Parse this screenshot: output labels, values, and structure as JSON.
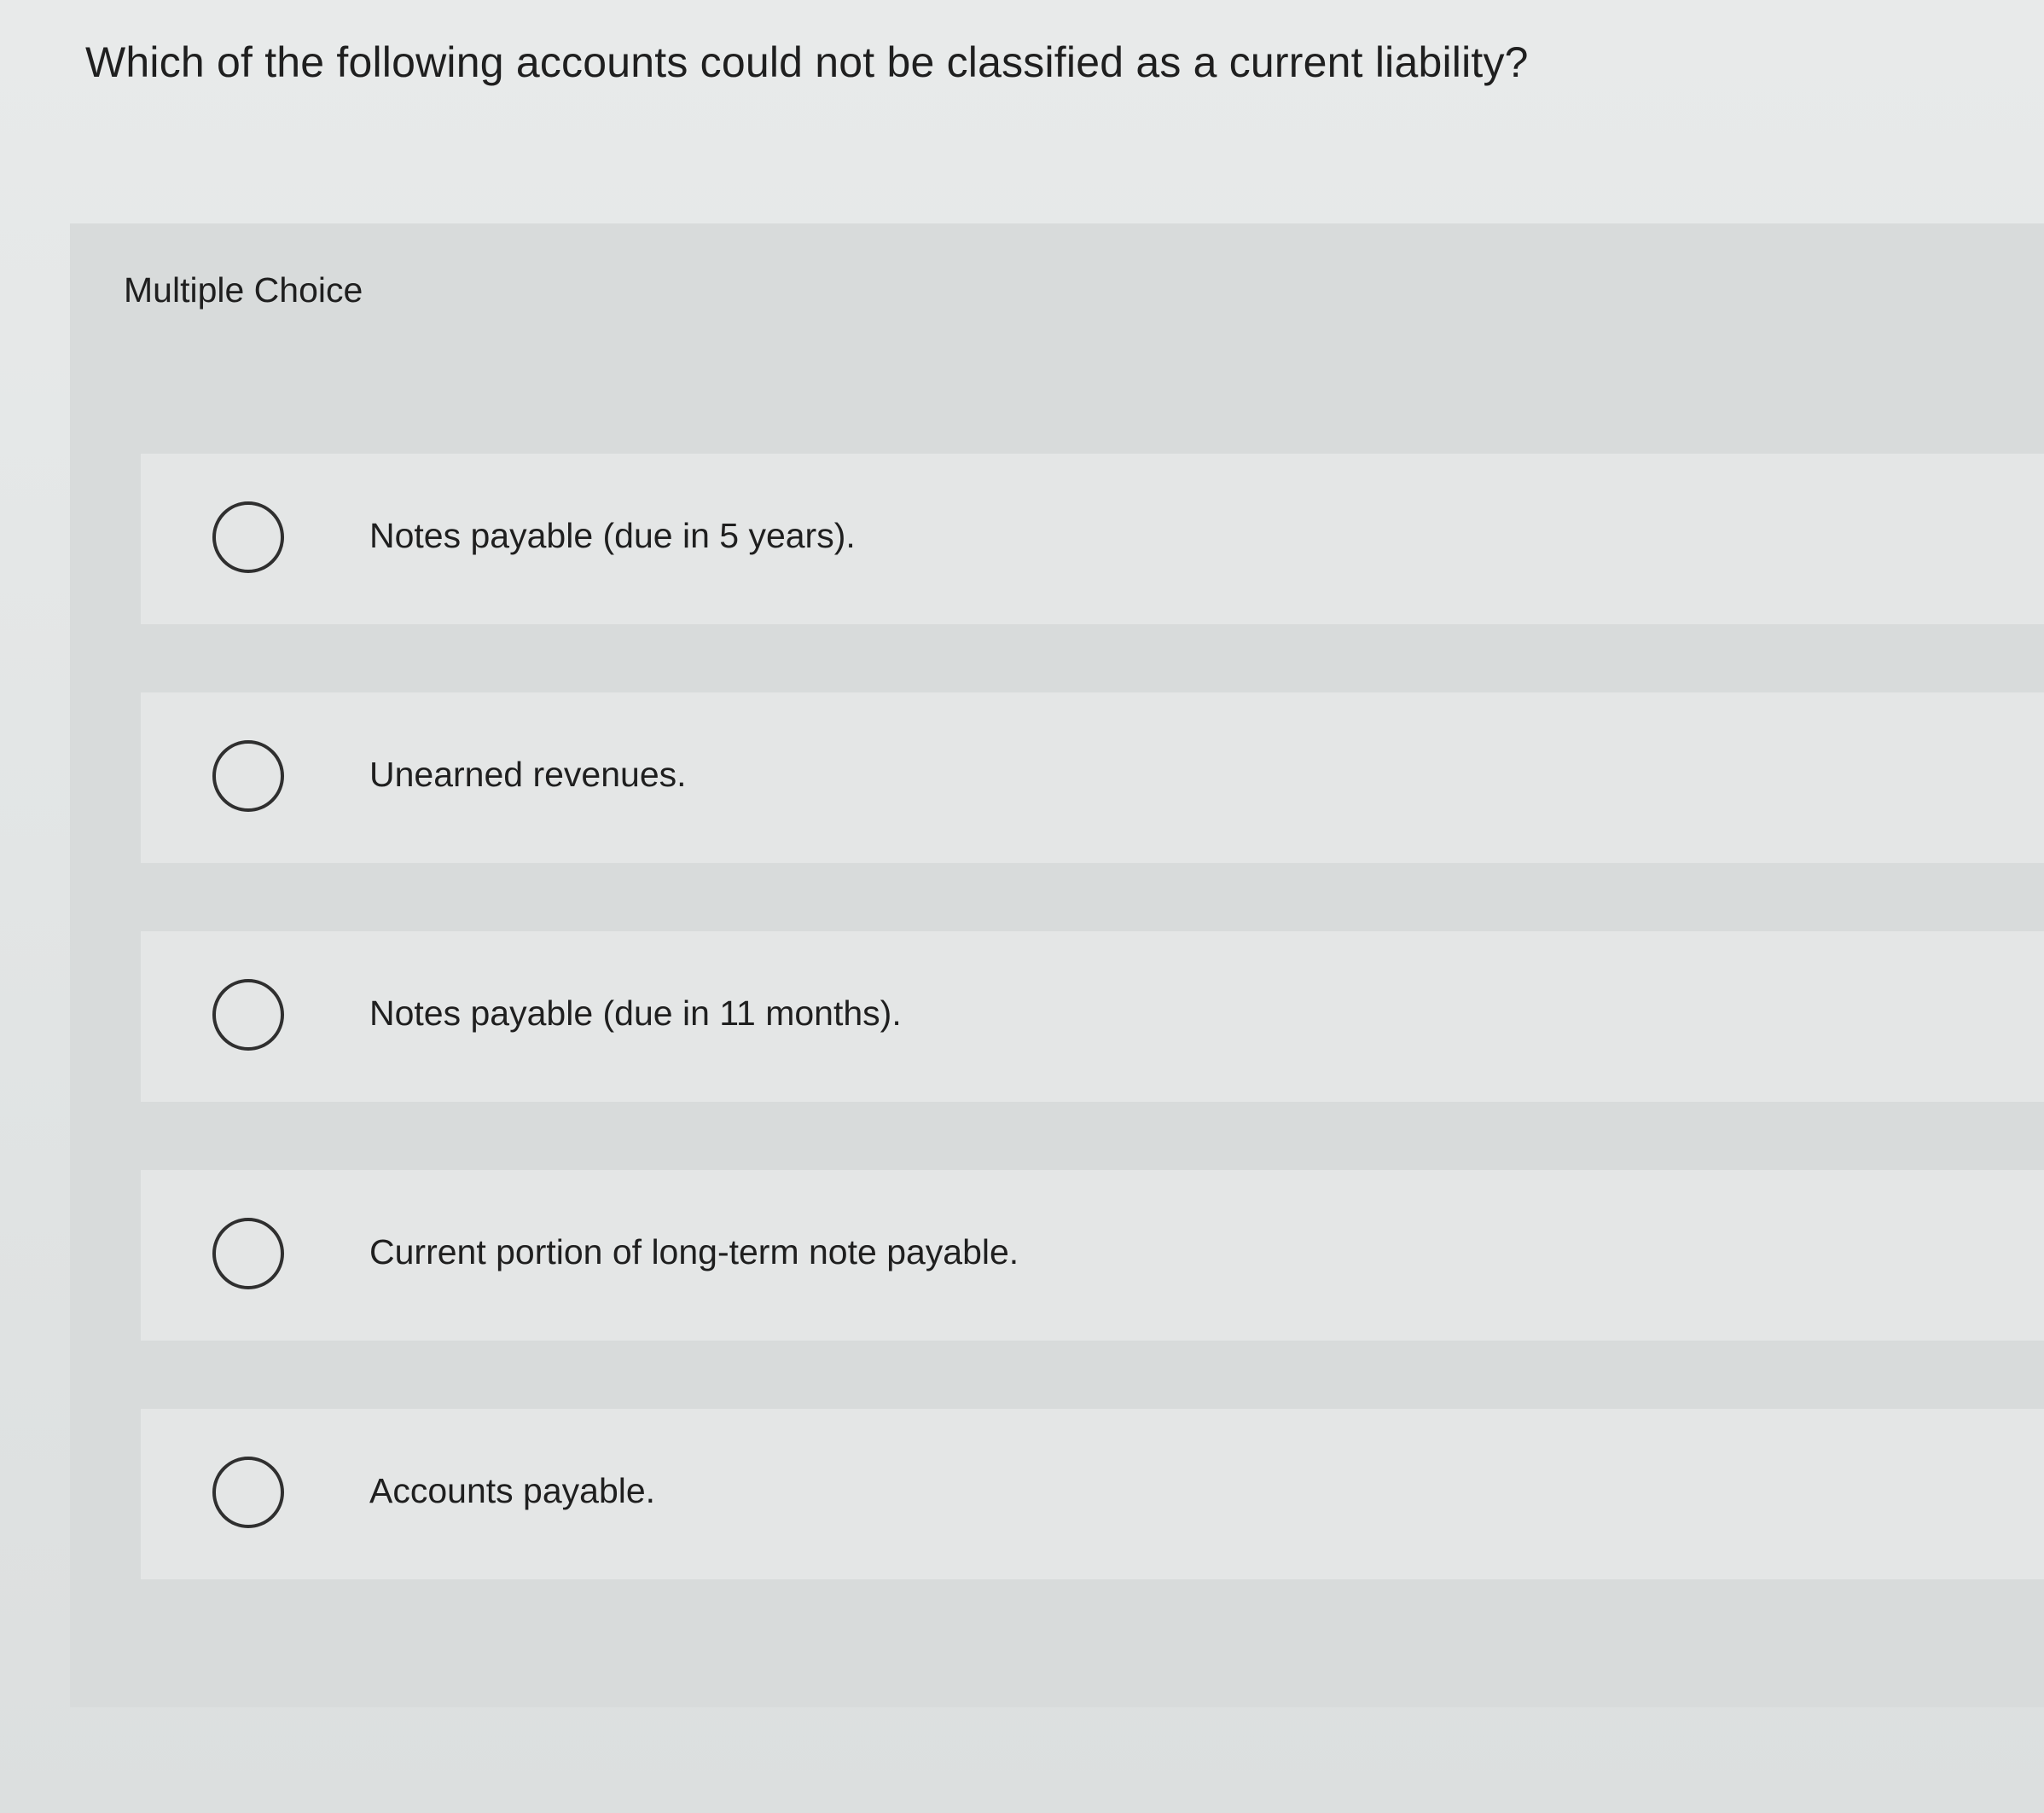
{
  "question": {
    "text": "Which of the following accounts could not be classified as a current liability?"
  },
  "panel": {
    "label": "Multiple Choice"
  },
  "options": [
    {
      "label": "Notes payable (due in 5 years).",
      "selected": false
    },
    {
      "label": "Unearned revenues.",
      "selected": false
    },
    {
      "label": "Notes payable (due in 11 months).",
      "selected": false
    },
    {
      "label": "Current portion of long-term note payable.",
      "selected": false
    },
    {
      "label": "Accounts payable.",
      "selected": false
    }
  ]
}
